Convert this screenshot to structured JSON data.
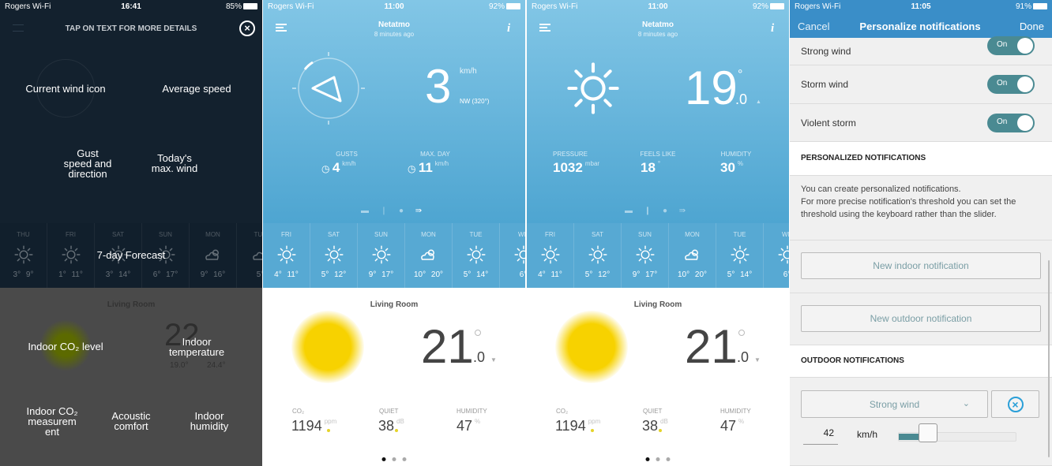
{
  "overlay": {
    "status": {
      "carrier": "Rogers Wi-Fi",
      "time": "16:41",
      "battery": "85%"
    },
    "title": "TAP ON TEXT FOR MORE DETAILS",
    "labels": {
      "wind_icon": "Current wind icon",
      "avg_speed": "Average speed",
      "gust": "Gust\nspeed and\ndirection",
      "max_wind": "Today's\nmax. wind",
      "forecast": "7-day Forecast",
      "co2_level": "Indoor CO₂ level",
      "indoor_temp": "Indoor\ntemperature",
      "co2_measure": "Indoor CO₂\nmeasurem\nent",
      "acoustic": "Acoustic\ncomfort",
      "humidity": "Indoor\nhumidity"
    },
    "bg": {
      "room": "Living Room",
      "min": "19.0°",
      "max": "24.4°",
      "temp": "22"
    },
    "forecast": [
      {
        "day": "THU",
        "icon": "sun-icon",
        "temps": "3° 9°"
      },
      {
        "day": "FRI",
        "icon": "sun-icon",
        "temps": "1° 11°"
      },
      {
        "day": "SAT",
        "icon": "sun-icon",
        "temps": "3° 14°"
      },
      {
        "day": "SUN",
        "icon": "sun-icon",
        "temps": "6° 17°"
      },
      {
        "day": "MON",
        "icon": "cloud-sun-icon",
        "temps": "9° 16°"
      },
      {
        "day": "TUE",
        "icon": "cloud-icon",
        "temps": "5°"
      }
    ]
  },
  "wind": {
    "status": {
      "carrier": "Rogers Wi-Fi",
      "time": "11:00",
      "battery": "92%"
    },
    "title": "Netatmo",
    "subtitle": "8 minutes ago",
    "speed": "3",
    "unit": "km/h",
    "direction": "NW (320°)",
    "gusts_label": "GUSTS",
    "gusts": "4",
    "maxday_label": "MAX. DAY",
    "maxday": "11"
  },
  "temp": {
    "status": {
      "carrier": "Rogers Wi-Fi",
      "time": "11:00",
      "battery": "92%"
    },
    "title": "Netatmo",
    "subtitle": "8 minutes ago",
    "value": "19",
    "decimal": ".0",
    "degree": "°",
    "pressure_label": "PRESSURE",
    "pressure": "1032",
    "pressure_unit": "mbar",
    "feels_label": "FEELS LIKE",
    "feels": "18",
    "feels_unit": "°",
    "hum_label": "HUMIDITY",
    "hum": "30",
    "hum_unit": "%"
  },
  "forecast": [
    {
      "day": "FRI",
      "icon": "sun-icon",
      "temps": "4° 11°"
    },
    {
      "day": "SAT",
      "icon": "sun-icon",
      "temps": "5° 12°"
    },
    {
      "day": "SUN",
      "icon": "sun-icon",
      "temps": "9° 17°"
    },
    {
      "day": "MON",
      "icon": "cloud-sun-icon",
      "temps": "10° 20°"
    },
    {
      "day": "TUE",
      "icon": "sun-icon",
      "temps": "5° 14°"
    },
    {
      "day": "WE",
      "icon": "sun-icon",
      "temps": "6°"
    }
  ],
  "indoor": {
    "room": "Living Room",
    "temp": "21",
    "decimal": ".0",
    "co2_label": "CO₂",
    "co2": "1194",
    "co2_unit": "ppm",
    "quiet_label": "QUIET",
    "quiet": "38",
    "quiet_unit": "dB",
    "hum_label": "HUMIDITY",
    "hum": "47",
    "hum_unit": "%",
    "page_index": 1,
    "page_count": 3
  },
  "notif": {
    "status": {
      "carrier": "Rogers Wi-Fi",
      "time": "11:05",
      "battery": "91%"
    },
    "cancel": "Cancel",
    "title": "Personalize notifications",
    "done": "Done",
    "toggles": [
      {
        "label": "Strong wind",
        "state": "On"
      },
      {
        "label": "Storm wind",
        "state": "On"
      },
      {
        "label": "Violent storm",
        "state": "On"
      }
    ],
    "personal_header": "PERSONALIZED NOTIFICATIONS",
    "info": "You can create personalized notifications.\nFor more precise notification's threshold you can set the threshold using the keyboard rather than the slider.",
    "new_indoor": "New indoor notification",
    "new_outdoor": "New outdoor notification",
    "outdoor_header": "OUTDOOR NOTIFICATIONS",
    "select_value": "Strong wind",
    "threshold": "42",
    "threshold_unit": "km/h",
    "slider_fraction": 0.25
  },
  "colors": {
    "nav": "#3a8ec8",
    "toggle": "#4a8a92",
    "accent": "#2a9fd8",
    "sun": "#f7d200"
  }
}
